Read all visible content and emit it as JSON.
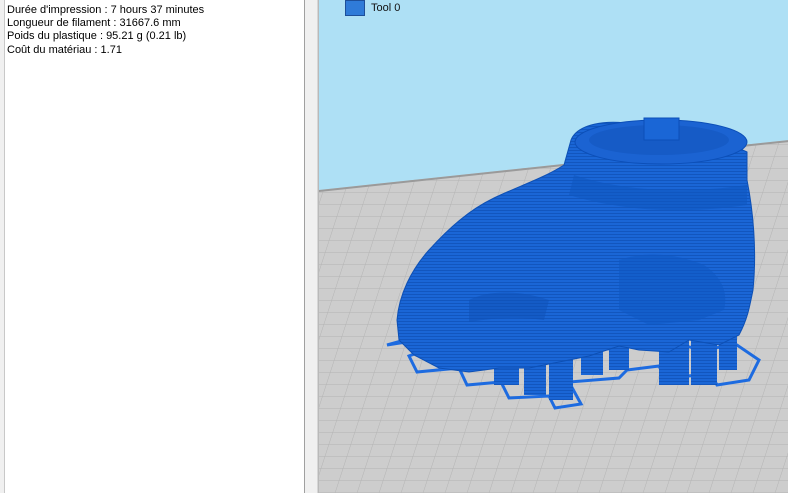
{
  "stats": {
    "print_time": "Durée d'impression : 7 hours 37 minutes",
    "filament_length": "Longueur de filament : 31667.6 mm",
    "plastic_weight": "Poids du plastique : 95.21 g (0.21 lb)",
    "material_cost": "Coût du matériau : 1.71"
  },
  "viewport": {
    "tools": [
      {
        "label": "Tool 0",
        "color": "#2f7bd8"
      }
    ],
    "colors": {
      "sky": "#aee0f5",
      "bed": "#cfcfcf",
      "grid": "#b5b5b5",
      "model": "#1565d8",
      "model_shadow": "#0c4fb8"
    }
  }
}
